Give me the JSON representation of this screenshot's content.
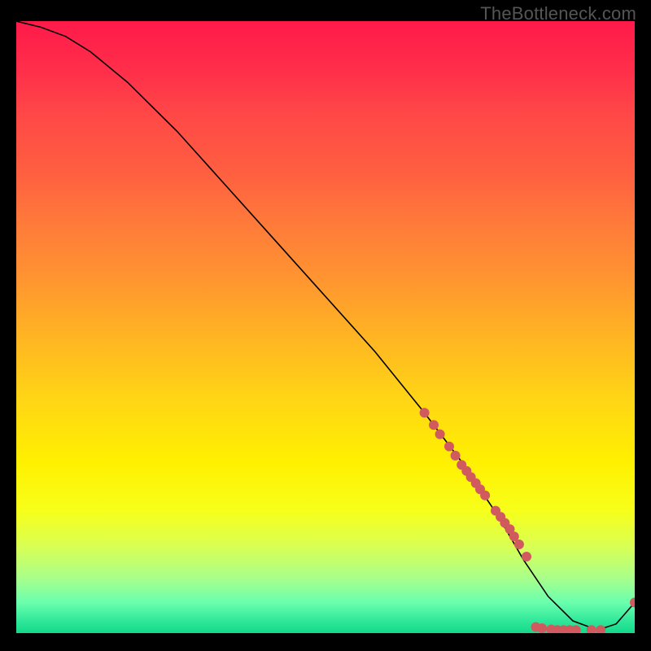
{
  "watermark": "TheBottleneck.com",
  "chart_data": {
    "type": "line",
    "title": "",
    "xlabel": "",
    "ylabel": "",
    "xlim": [
      0,
      100
    ],
    "ylim": [
      0,
      100
    ],
    "grid": false,
    "series": [
      {
        "name": "curve",
        "x": [
          0,
          4,
          8,
          12,
          18,
          26,
          34,
          42,
          50,
          58,
          66,
          72,
          78,
          82,
          86,
          90,
          94,
          97,
          100
        ],
        "y": [
          100,
          99,
          97.5,
          95,
          90,
          82,
          73,
          64,
          55,
          46,
          36,
          28,
          19,
          12,
          6,
          2,
          0.5,
          1.5,
          5
        ]
      }
    ],
    "markers": [
      {
        "x": 66.0,
        "y": 36.0
      },
      {
        "x": 67.5,
        "y": 34.0
      },
      {
        "x": 68.5,
        "y": 32.5
      },
      {
        "x": 70.0,
        "y": 30.5
      },
      {
        "x": 71.0,
        "y": 29.0
      },
      {
        "x": 72.0,
        "y": 27.5
      },
      {
        "x": 72.8,
        "y": 26.5
      },
      {
        "x": 73.5,
        "y": 25.5
      },
      {
        "x": 74.3,
        "y": 24.5
      },
      {
        "x": 75.0,
        "y": 23.5
      },
      {
        "x": 75.8,
        "y": 22.5
      },
      {
        "x": 77.5,
        "y": 20.0
      },
      {
        "x": 78.3,
        "y": 19.0
      },
      {
        "x": 79.0,
        "y": 18.0
      },
      {
        "x": 79.8,
        "y": 17.0
      },
      {
        "x": 80.5,
        "y": 15.8
      },
      {
        "x": 81.3,
        "y": 14.5
      },
      {
        "x": 82.5,
        "y": 12.5
      },
      {
        "x": 84.0,
        "y": 1.0
      },
      {
        "x": 85.0,
        "y": 0.8
      },
      {
        "x": 86.5,
        "y": 0.6
      },
      {
        "x": 87.5,
        "y": 0.5
      },
      {
        "x": 88.5,
        "y": 0.5
      },
      {
        "x": 89.5,
        "y": 0.5
      },
      {
        "x": 90.5,
        "y": 0.5
      },
      {
        "x": 93.0,
        "y": 0.5
      },
      {
        "x": 94.5,
        "y": 0.5
      },
      {
        "x": 100.0,
        "y": 5.0
      }
    ],
    "marker_color": "#d15a5f",
    "line_color": "#000000"
  }
}
